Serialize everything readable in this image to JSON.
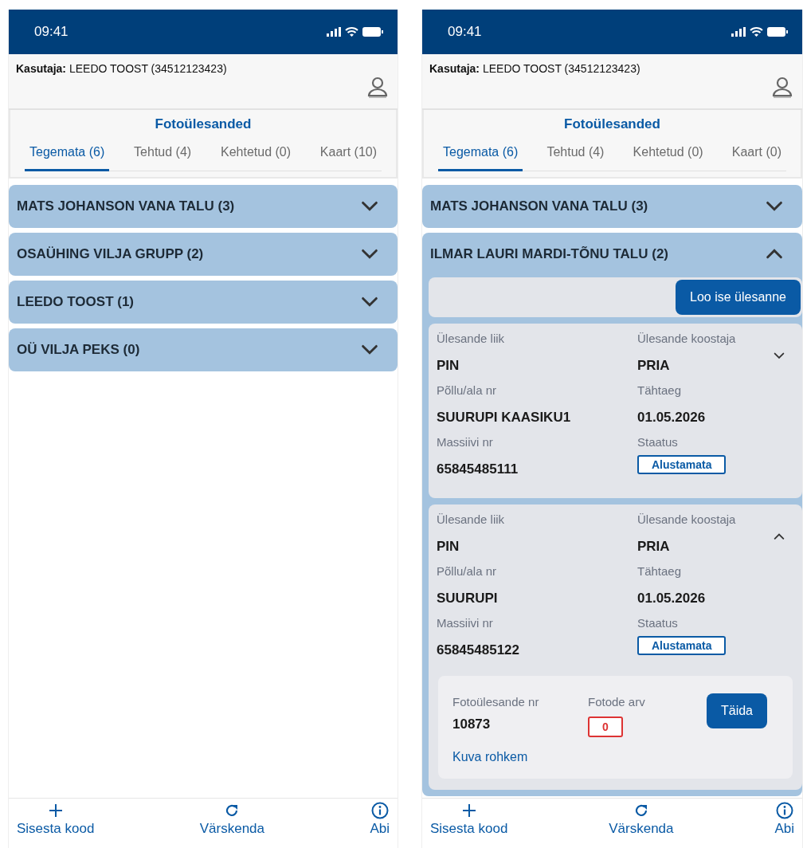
{
  "phones": [
    {
      "status_time": "09:41",
      "user": "**Kasutaja:** LEEDO TOOST (34512123423)",
      "title": "Fotoülesanded",
      "tabs": [
        {
          "label": "Tegemata (6)",
          "selected": true
        },
        {
          "label": "Tehtud (4)",
          "selected": false
        },
        {
          "label": "Kehtetud (0)",
          "selected": false
        },
        {
          "label": "Kaart (10)",
          "selected": false
        }
      ],
      "groups": [
        {
          "title": "MATS JOHANSON VANA TALU (3)",
          "expanded": false
        },
        {
          "title": "OSAÜHING VILJA GRUPP (2)",
          "expanded": false
        },
        {
          "title": "LEEDO TOOST (1)",
          "expanded": false
        },
        {
          "title": "OÜ VILJA PEKS (0)",
          "expanded": false
        }
      ],
      "nav": [
        {
          "kind": "add",
          "label": "Sisesta kood"
        },
        {
          "kind": "refresh",
          "label": "Värskenda"
        },
        {
          "kind": "info",
          "label": "Abi"
        }
      ]
    },
    {
      "status_time": "09:41",
      "user": "**Kasutaja:** LEEDO TOOST (34512123423)",
      "title": "Fotoülesanded",
      "tabs": [
        {
          "label": "Tegemata (6)",
          "selected": true
        },
        {
          "label": "Tehtud (4)",
          "selected": false
        },
        {
          "label": "Kehtetud (0)",
          "selected": false
        },
        {
          "label": "Kaart (0)",
          "selected": false
        }
      ],
      "groups": [
        {
          "title": "MATS JOHANSON VANA TALU (3)",
          "expanded": false
        },
        {
          "title": "ILMAR LAURI MARDI-TÕNU TALU (2)",
          "expanded": true,
          "create_button": "Loo ise ülesanne",
          "tasks": [
            {
              "expanded": false,
              "fields": [
                {
                  "label": "Ülesande liik",
                  "value": "PIN",
                  "kind": "text"
                },
                {
                  "label": "Ülesande koostaja",
                  "value": "PRIA",
                  "kind": "text"
                },
                {
                  "label": "Põllu/ala nr",
                  "value": "SUURUPI KAASIKU1",
                  "kind": "text"
                },
                {
                  "label": "Tähtaeg",
                  "value": "01.05.2026",
                  "kind": "text"
                },
                {
                  "label": "Massiivi nr",
                  "value": "65845485111",
                  "kind": "text"
                },
                {
                  "label": "Staatus",
                  "value": "Alustamata",
                  "kind": "badge"
                }
              ]
            },
            {
              "expanded": true,
              "fields": [
                {
                  "label": "Ülesande liik",
                  "value": "PIN",
                  "kind": "text"
                },
                {
                  "label": "Ülesande koostaja",
                  "value": "PRIA",
                  "kind": "text"
                },
                {
                  "label": "Põllu/ala nr",
                  "value": "SUURUPI",
                  "kind": "text"
                },
                {
                  "label": "Tähtaeg",
                  "value": "01.05.2026",
                  "kind": "text"
                },
                {
                  "label": "Massiivi nr",
                  "value": "65845485122",
                  "kind": "text"
                },
                {
                  "label": "Staatus",
                  "value": "Alustamata",
                  "kind": "badge"
                }
              ],
              "photo_tasks": [
                {
                  "number_label": "Fotoülesande nr",
                  "number": "10873",
                  "count_label": "Fotode arv",
                  "count": "0",
                  "action": "Täida",
                  "more": "Kuva rohkem"
                }
              ]
            }
          ]
        }
      ],
      "nav": [
        {
          "kind": "add",
          "label": "Sisesta kood"
        },
        {
          "kind": "refresh",
          "label": "Värskenda"
        },
        {
          "kind": "info",
          "label": "Abi"
        }
      ]
    }
  ]
}
